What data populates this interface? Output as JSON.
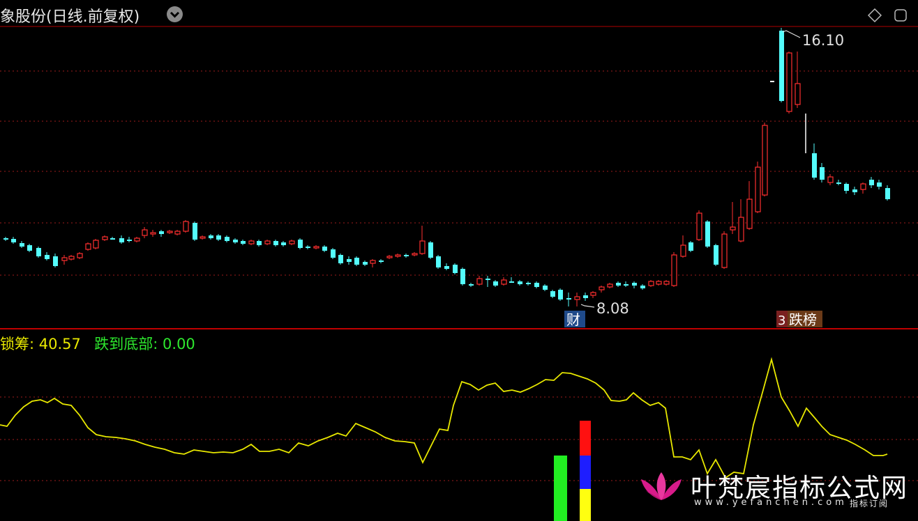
{
  "header": {
    "title": "象股份(日线.前复权)",
    "dropdown_icon": "chevron-down-icon",
    "right_icons": [
      "diamond-icon",
      "expand-icon"
    ]
  },
  "price_chart": {
    "high_label": "16.10",
    "low_label": "8.08",
    "badges": {
      "finance": "财",
      "ranking_left": "3",
      "ranking": "跌榜"
    },
    "colors": {
      "up": "#ff3030",
      "down": "#54fcfc",
      "grid": "#a01c1c",
      "frame": "#b00000"
    }
  },
  "indicator": {
    "line1_name": "锁筹",
    "line1_value": "40.57",
    "line2_name": "跌到底部",
    "line2_value": "0.00",
    "colors": {
      "line1": "#e8e800",
      "line2": "#2ee82e"
    }
  },
  "watermark": {
    "title": "叶梵宸指标公式网",
    "url": "www.yefanchen.com",
    "sub": "指标订阅"
  }
}
